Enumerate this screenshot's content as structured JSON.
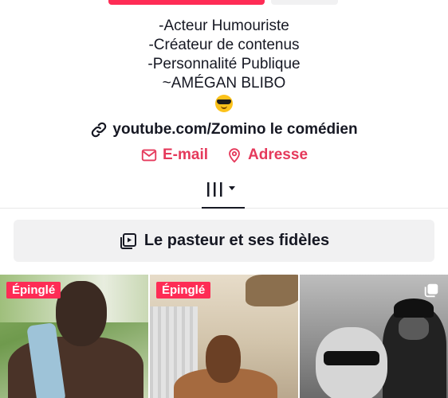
{
  "profile": {
    "bio_lines": [
      "-Acteur Humouriste",
      "-Créateur de contenus",
      "-Personnalité Publique",
      "~AMÉGAN BLIBO"
    ],
    "bio_emoji": "smiling-face-with-sunglasses",
    "link": "youtube.com/Zomino le comédien",
    "email_label": "E-mail",
    "address_label": "Adresse"
  },
  "playlist": {
    "label": "Le pasteur et ses fidèles"
  },
  "videos": [
    {
      "badge": "Épinglé"
    },
    {
      "badge": "Épinglé"
    },
    {
      "multi": true
    }
  ],
  "colors": {
    "accent": "#fe2c55",
    "contact": "#e5395b",
    "text": "#161823",
    "surface": "#f1f1f2"
  },
  "icons": {
    "link": "link-icon",
    "email": "mail-icon",
    "address": "location-pin-icon",
    "tab": "grid-icon",
    "playlist": "playlist-icon",
    "multi": "multi-video-icon"
  }
}
